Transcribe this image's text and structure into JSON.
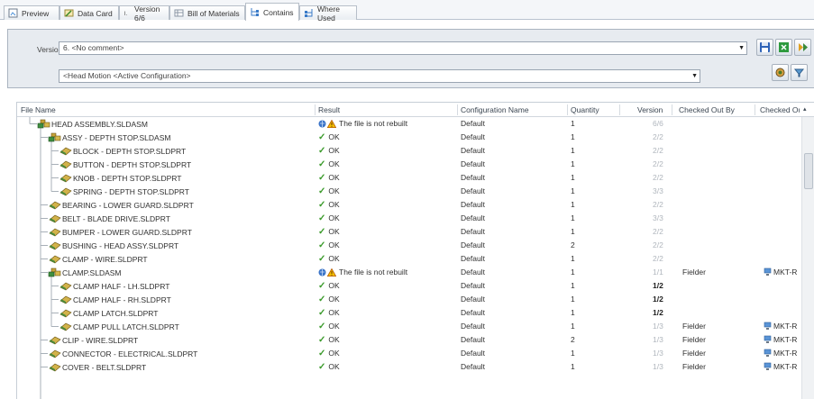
{
  "tabs": [
    {
      "label": "Preview",
      "icon": "preview-icon",
      "active": false
    },
    {
      "label": "Data Card",
      "icon": "data-card-icon",
      "active": false
    },
    {
      "label": "Version 6/6",
      "icon": "version-icon",
      "active": false
    },
    {
      "label": "Bill of Materials",
      "icon": "bom-icon",
      "active": false
    },
    {
      "label": "Contains",
      "icon": "contains-icon",
      "active": true
    },
    {
      "label": "Where Used",
      "icon": "where-used-icon",
      "active": false
    }
  ],
  "version": {
    "label": "Version:",
    "value": "6. <No comment>"
  },
  "configuration": {
    "value": "<Head Motion <Active Configuration>"
  },
  "columns": [
    "File Name",
    "Result",
    "Configuration Name",
    "Quantity",
    "Version",
    "Checked Out By",
    "Checked Out In"
  ],
  "rows": [
    {
      "name": "HEAD ASSEMBLY.SLDASM",
      "type": "asm",
      "level": 0,
      "result": "The file is not rebuilt",
      "warn": true,
      "config": "Default",
      "qty": "1",
      "version": "6/6",
      "vbold": false,
      "checked_by": "",
      "checked_in": ""
    },
    {
      "name": "ASSY - DEPTH STOP.SLDASM",
      "type": "asm",
      "level": 1,
      "result": "OK",
      "warn": false,
      "config": "Default",
      "qty": "1",
      "version": "2/2",
      "vbold": false,
      "checked_by": "",
      "checked_in": ""
    },
    {
      "name": "BLOCK - DEPTH STOP.SLDPRT",
      "type": "part",
      "level": 2,
      "result": "OK",
      "warn": false,
      "config": "Default",
      "qty": "1",
      "version": "2/2",
      "vbold": false,
      "checked_by": "",
      "checked_in": ""
    },
    {
      "name": "BUTTON - DEPTH STOP.SLDPRT",
      "type": "part",
      "level": 2,
      "result": "OK",
      "warn": false,
      "config": "Default",
      "qty": "1",
      "version": "2/2",
      "vbold": false,
      "checked_by": "",
      "checked_in": ""
    },
    {
      "name": "KNOB - DEPTH STOP.SLDPRT",
      "type": "part",
      "level": 2,
      "result": "OK",
      "warn": false,
      "config": "Default",
      "qty": "1",
      "version": "2/2",
      "vbold": false,
      "checked_by": "",
      "checked_in": ""
    },
    {
      "name": "SPRING - DEPTH STOP.SLDPRT",
      "type": "part",
      "level": 2,
      "result": "OK",
      "warn": false,
      "config": "Default",
      "qty": "1",
      "version": "3/3",
      "vbold": false,
      "checked_by": "",
      "checked_in": ""
    },
    {
      "name": "BEARING - LOWER GUARD.SLDPRT",
      "type": "part",
      "level": 1,
      "result": "OK",
      "warn": false,
      "config": "Default",
      "qty": "1",
      "version": "2/2",
      "vbold": false,
      "checked_by": "",
      "checked_in": ""
    },
    {
      "name": "BELT - BLADE DRIVE.SLDPRT",
      "type": "part",
      "level": 1,
      "result": "OK",
      "warn": false,
      "config": "Default",
      "qty": "1",
      "version": "3/3",
      "vbold": false,
      "checked_by": "",
      "checked_in": ""
    },
    {
      "name": "BUMPER - LOWER GUARD.SLDPRT",
      "type": "part",
      "level": 1,
      "result": "OK",
      "warn": false,
      "config": "Default",
      "qty": "1",
      "version": "2/2",
      "vbold": false,
      "checked_by": "",
      "checked_in": ""
    },
    {
      "name": "BUSHING - HEAD ASSY.SLDPRT",
      "type": "part",
      "level": 1,
      "result": "OK",
      "warn": false,
      "config": "Default",
      "qty": "2",
      "version": "2/2",
      "vbold": false,
      "checked_by": "",
      "checked_in": ""
    },
    {
      "name": "CLAMP - WIRE.SLDPRT",
      "type": "part",
      "level": 1,
      "result": "OK",
      "warn": false,
      "config": "Default",
      "qty": "1",
      "version": "2/2",
      "vbold": false,
      "checked_by": "",
      "checked_in": ""
    },
    {
      "name": "CLAMP.SLDASM",
      "type": "asm",
      "level": 1,
      "result": "The file is not rebuilt",
      "warn": true,
      "config": "Default",
      "qty": "1",
      "version": "1/1",
      "vbold": false,
      "checked_by": "Fielder",
      "checked_in": "MKT-R"
    },
    {
      "name": "CLAMP HALF - LH.SLDPRT",
      "type": "part",
      "level": 2,
      "result": "OK",
      "warn": false,
      "config": "Default",
      "qty": "1",
      "version": "1/2",
      "vbold": true,
      "checked_by": "",
      "checked_in": ""
    },
    {
      "name": "CLAMP HALF - RH.SLDPRT",
      "type": "part",
      "level": 2,
      "result": "OK",
      "warn": false,
      "config": "Default",
      "qty": "1",
      "version": "1/2",
      "vbold": true,
      "checked_by": "",
      "checked_in": ""
    },
    {
      "name": "CLAMP LATCH.SLDPRT",
      "type": "part",
      "level": 2,
      "result": "OK",
      "warn": false,
      "config": "Default",
      "qty": "1",
      "version": "1/2",
      "vbold": true,
      "checked_by": "",
      "checked_in": ""
    },
    {
      "name": "CLAMP PULL LATCH.SLDPRT",
      "type": "part",
      "level": 2,
      "result": "OK",
      "warn": false,
      "config": "Default",
      "qty": "1",
      "version": "1/3",
      "vbold": false,
      "checked_by": "Fielder",
      "checked_in": "MKT-R"
    },
    {
      "name": "CLIP - WIRE.SLDPRT",
      "type": "part",
      "level": 1,
      "result": "OK",
      "warn": false,
      "config": "Default",
      "qty": "2",
      "version": "1/3",
      "vbold": false,
      "checked_by": "Fielder",
      "checked_in": "MKT-R"
    },
    {
      "name": "CONNECTOR - ELECTRICAL.SLDPRT",
      "type": "part",
      "level": 1,
      "result": "OK",
      "warn": false,
      "config": "Default",
      "qty": "1",
      "version": "1/3",
      "vbold": false,
      "checked_by": "Fielder",
      "checked_in": "MKT-R"
    },
    {
      "name": "COVER - BELT.SLDPRT",
      "type": "part",
      "level": 1,
      "result": "OK",
      "warn": false,
      "config": "Default",
      "qty": "1",
      "version": "1/3",
      "vbold": false,
      "checked_by": "Fielder",
      "checked_in": "MKT-R"
    }
  ]
}
